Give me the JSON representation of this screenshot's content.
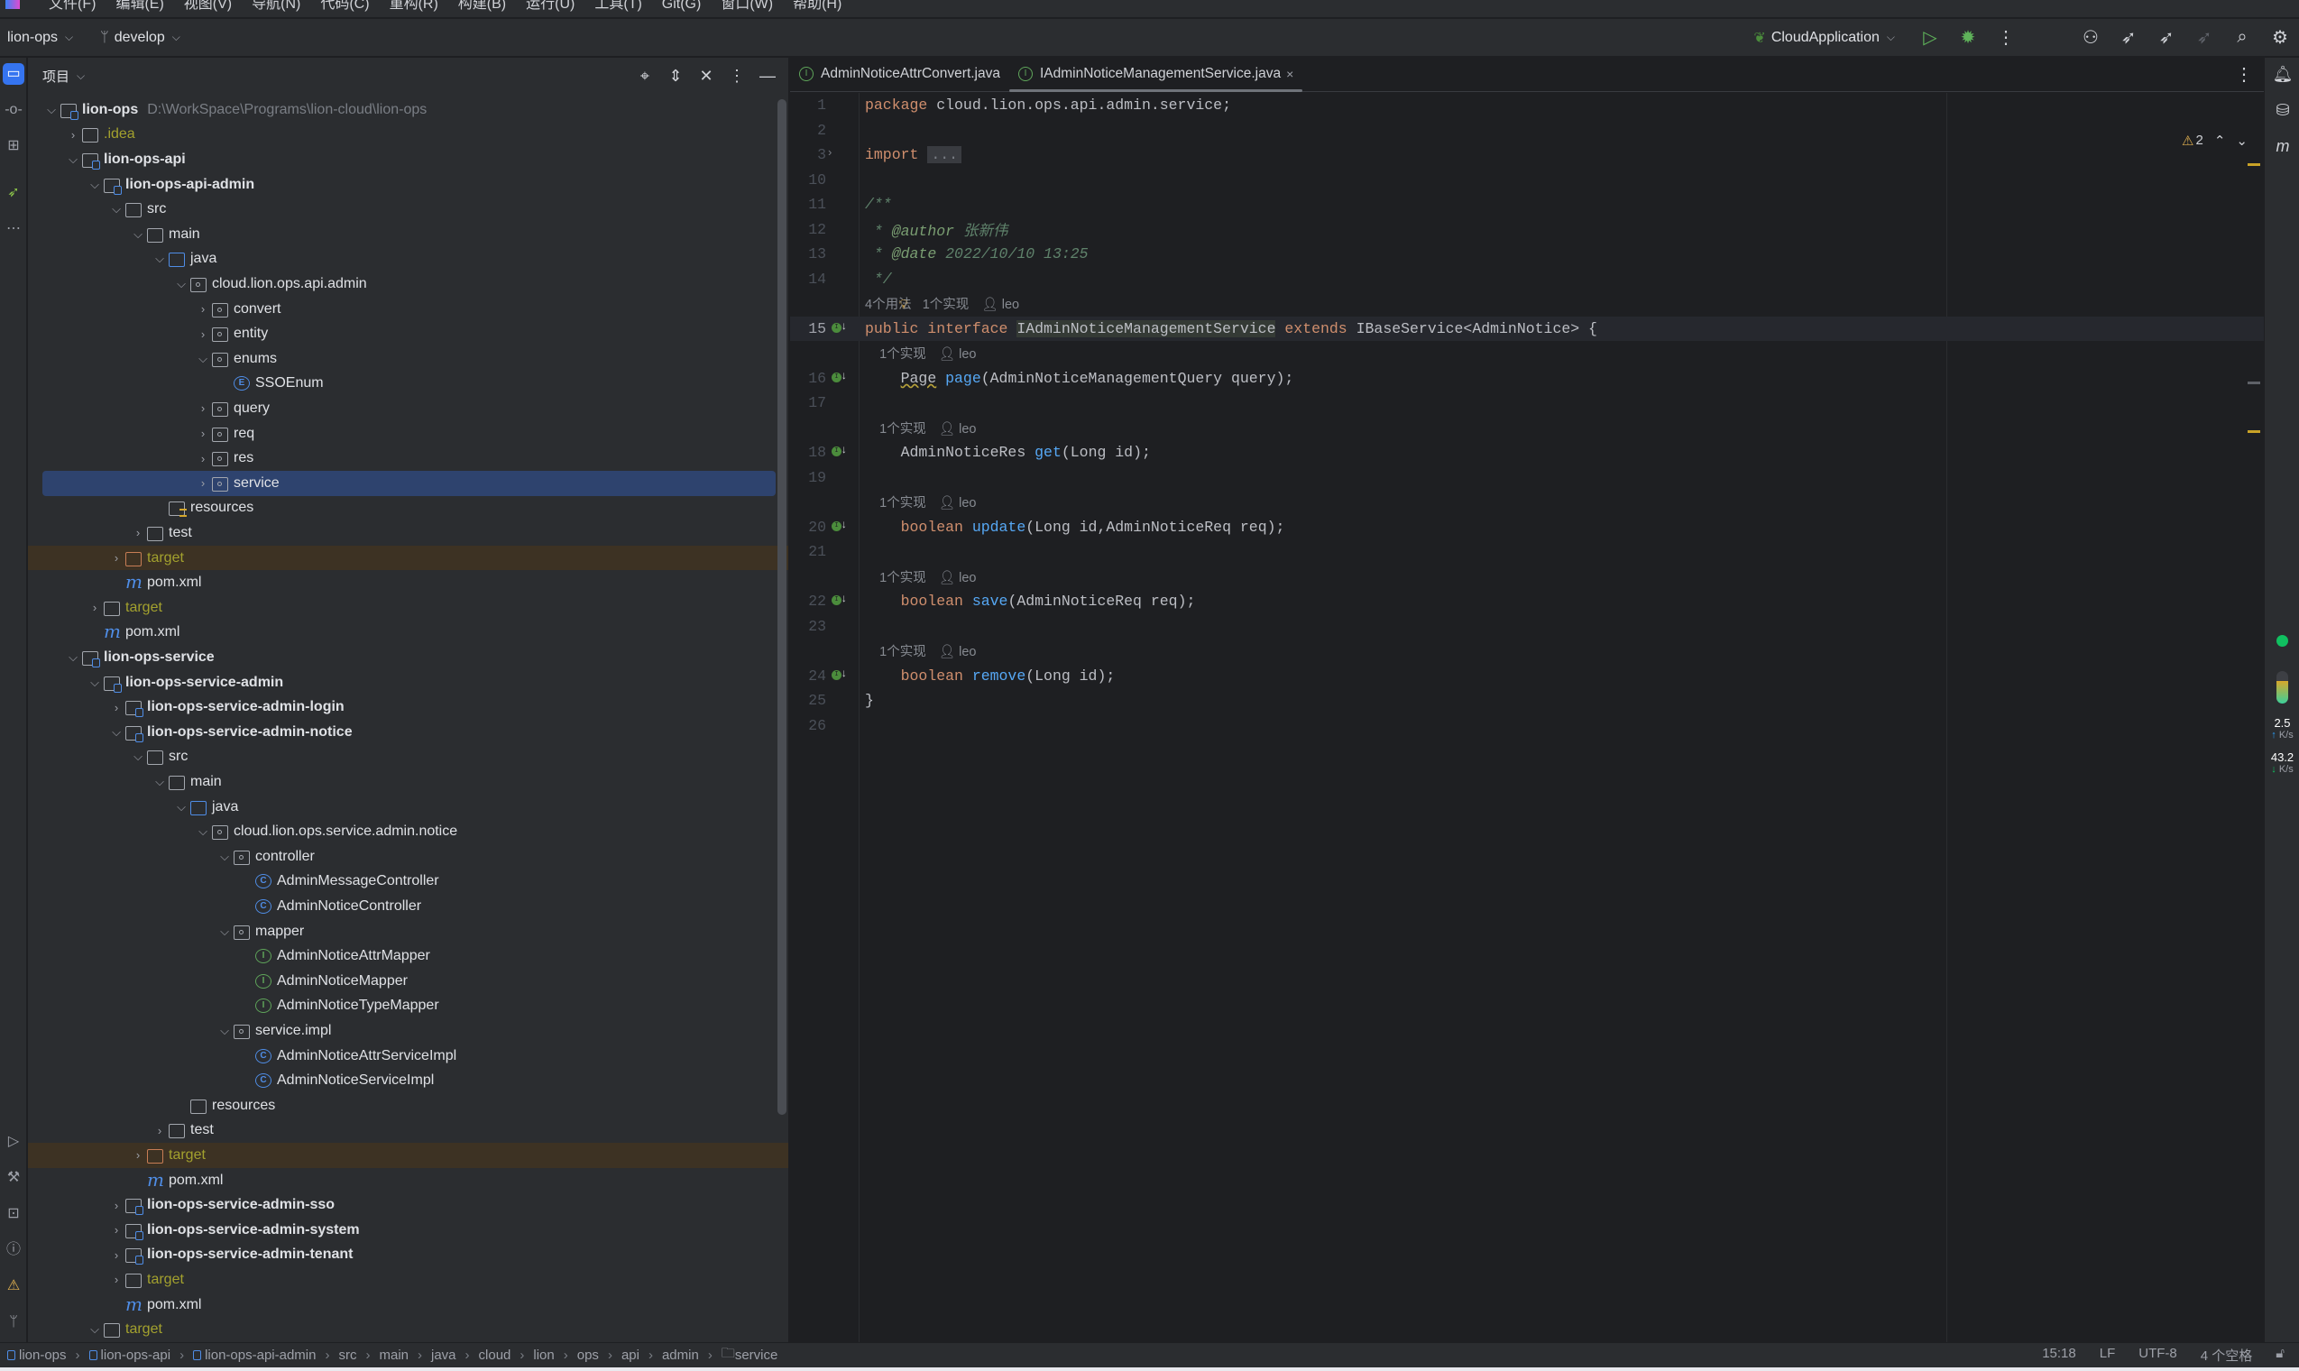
{
  "menu": [
    "文件(F)",
    "编辑(E)",
    "视图(V)",
    "导航(N)",
    "代码(C)",
    "重构(R)",
    "构建(B)",
    "运行(U)",
    "工具(T)",
    "Git(G)",
    "窗口(W)",
    "帮助(H)"
  ],
  "toolbar": {
    "project": "lion-ops",
    "branch": "develop",
    "run_config": "CloudApplication",
    "icons": [
      "run-icon",
      "debug-icon",
      "more-icon",
      "add-user-icon",
      "rocket-run-icon",
      "rocket-debug-icon",
      "rocket-icon",
      "search-icon",
      "settings-icon"
    ]
  },
  "project_panel": {
    "title": "项目",
    "tree": [
      {
        "level": 0,
        "label": "lion-ops",
        "type": "module",
        "state": "open",
        "bold": true,
        "path": "D:\\WorkSpace\\Programs\\lion-cloud\\lion-ops"
      },
      {
        "level": 1,
        "label": ".idea",
        "type": "folder",
        "state": "closed",
        "olive": true
      },
      {
        "level": 1,
        "label": "lion-ops-api",
        "type": "module",
        "state": "open",
        "bold": true
      },
      {
        "level": 2,
        "label": "lion-ops-api-admin",
        "type": "module",
        "state": "open",
        "bold": true
      },
      {
        "level": 3,
        "label": "src",
        "type": "folder",
        "state": "open"
      },
      {
        "level": 4,
        "label": "main",
        "type": "folder",
        "state": "open"
      },
      {
        "level": 5,
        "label": "java",
        "type": "source",
        "state": "open"
      },
      {
        "level": 6,
        "label": "cloud.lion.ops.api.admin",
        "type": "package",
        "state": "open"
      },
      {
        "level": 7,
        "label": "convert",
        "type": "package",
        "state": "closed"
      },
      {
        "level": 7,
        "label": "entity",
        "type": "package",
        "state": "closed"
      },
      {
        "level": 7,
        "label": "enums",
        "type": "package",
        "state": "open"
      },
      {
        "level": 8,
        "label": "SSOEnum",
        "type": "enum"
      },
      {
        "level": 7,
        "label": "query",
        "type": "package",
        "state": "closed"
      },
      {
        "level": 7,
        "label": "req",
        "type": "package",
        "state": "closed"
      },
      {
        "level": 7,
        "label": "res",
        "type": "package",
        "state": "closed"
      },
      {
        "level": 7,
        "label": "service",
        "type": "package",
        "state": "closed",
        "selected": true
      },
      {
        "level": 5,
        "label": "resources",
        "type": "resources"
      },
      {
        "level": 4,
        "label": "test",
        "type": "folder",
        "state": "closed"
      },
      {
        "level": 3,
        "label": "target",
        "type": "excluded",
        "state": "closed",
        "olive": true,
        "highlight": true
      },
      {
        "level": 3,
        "label": "pom.xml",
        "type": "maven"
      },
      {
        "level": 2,
        "label": "target",
        "type": "folder",
        "state": "closed",
        "olive": true
      },
      {
        "level": 2,
        "label": "pom.xml",
        "type": "maven"
      },
      {
        "level": 1,
        "label": "lion-ops-service",
        "type": "module",
        "state": "open",
        "bold": true
      },
      {
        "level": 2,
        "label": "lion-ops-service-admin",
        "type": "module",
        "state": "open",
        "bold": true
      },
      {
        "level": 3,
        "label": "lion-ops-service-admin-login",
        "type": "module",
        "state": "closed",
        "bold": true
      },
      {
        "level": 3,
        "label": "lion-ops-service-admin-notice",
        "type": "module",
        "state": "open",
        "bold": true
      },
      {
        "level": 4,
        "label": "src",
        "type": "folder",
        "state": "open"
      },
      {
        "level": 5,
        "label": "main",
        "type": "folder",
        "state": "open"
      },
      {
        "level": 6,
        "label": "java",
        "type": "source",
        "state": "open"
      },
      {
        "level": 7,
        "label": "cloud.lion.ops.service.admin.notice",
        "type": "package",
        "state": "open"
      },
      {
        "level": 8,
        "label": "controller",
        "type": "package",
        "state": "open"
      },
      {
        "level": 9,
        "label": "AdminMessageController",
        "type": "class"
      },
      {
        "level": 9,
        "label": "AdminNoticeController",
        "type": "class"
      },
      {
        "level": 8,
        "label": "mapper",
        "type": "package",
        "state": "open"
      },
      {
        "level": 9,
        "label": "AdminNoticeAttrMapper",
        "type": "interface"
      },
      {
        "level": 9,
        "label": "AdminNoticeMapper",
        "type": "interface"
      },
      {
        "level": 9,
        "label": "AdminNoticeTypeMapper",
        "type": "interface"
      },
      {
        "level": 8,
        "label": "service.impl",
        "type": "package",
        "state": "open"
      },
      {
        "level": 9,
        "label": "AdminNoticeAttrServiceImpl",
        "type": "class"
      },
      {
        "level": 9,
        "label": "AdminNoticeServiceImpl",
        "type": "class"
      },
      {
        "level": 6,
        "label": "resources",
        "type": "folder"
      },
      {
        "level": 5,
        "label": "test",
        "type": "folder",
        "state": "closed"
      },
      {
        "level": 4,
        "label": "target",
        "type": "excluded",
        "state": "closed",
        "olive": true,
        "highlight": true
      },
      {
        "level": 4,
        "label": "pom.xml",
        "type": "maven"
      },
      {
        "level": 3,
        "label": "lion-ops-service-admin-sso",
        "type": "module",
        "state": "closed",
        "bold": true
      },
      {
        "level": 3,
        "label": "lion-ops-service-admin-system",
        "type": "module",
        "state": "closed",
        "bold": true
      },
      {
        "level": 3,
        "label": "lion-ops-service-admin-tenant",
        "type": "module",
        "state": "closed",
        "bold": true
      },
      {
        "level": 3,
        "label": "target",
        "type": "folder",
        "state": "closed",
        "olive": true
      },
      {
        "level": 3,
        "label": "pom.xml",
        "type": "maven"
      },
      {
        "level": 2,
        "label": "target",
        "type": "folder",
        "state": "open",
        "olive": true
      }
    ]
  },
  "editor": {
    "tabs": [
      {
        "label": "AdminNoticeAttrConvert.java",
        "active": false
      },
      {
        "label": "IAdminNoticeManagementService.java",
        "active": true
      }
    ],
    "inspections": {
      "warnings": "2"
    },
    "lines": [
      {
        "n": "1",
        "t": [
          [
            "kw",
            "package "
          ],
          [
            "tx",
            "cloud.lion.ops.api.admin.service;"
          ]
        ]
      },
      {
        "n": "2",
        "t": []
      },
      {
        "n": "3",
        "fold": true,
        "t": [
          [
            "kw",
            "import "
          ],
          [
            "fold-ph",
            "..."
          ]
        ]
      },
      {
        "n": "10",
        "t": []
      },
      {
        "n": "11",
        "t": [
          [
            "cmg",
            "/**"
          ]
        ]
      },
      {
        "n": "12",
        "t": [
          [
            "cmg",
            " * "
          ],
          [
            "cm",
            "@author "
          ],
          [
            "cmg",
            "张新伟"
          ]
        ]
      },
      {
        "n": "13",
        "t": [
          [
            "cmg",
            " * "
          ],
          [
            "cm",
            "@date "
          ],
          [
            "cmg",
            "2022/10/10 13:25"
          ]
        ]
      },
      {
        "n": "14",
        "t": [
          [
            "cmg",
            " */"
          ]
        ]
      },
      {
        "hint": {
          "a": "4个用法",
          "b": "1个实现",
          "c": "leo"
        },
        "indent": ""
      },
      {
        "n": "15",
        "cur": true,
        "impl": true,
        "t": [
          [
            "kw",
            "public interface "
          ],
          [
            "tx hl",
            "IAdminNoticeManagementService"
          ],
          [
            "kw",
            " extends "
          ],
          [
            "tx",
            "IBaseService<AdminNotice> {"
          ]
        ]
      },
      {
        "hint": {
          "b": "1个实现",
          "c": "leo"
        },
        "indent": "    "
      },
      {
        "n": "16",
        "impl": true,
        "t": [
          [
            "tx",
            "    "
          ],
          [
            "tx ul",
            "Page"
          ],
          [
            "tx",
            " "
          ],
          [
            "fn",
            "page"
          ],
          [
            "tx",
            "(AdminNoticeManagementQuery query);"
          ]
        ]
      },
      {
        "n": "17",
        "t": []
      },
      {
        "hint": {
          "b": "1个实现",
          "c": "leo"
        },
        "indent": "    "
      },
      {
        "n": "18",
        "impl": true,
        "t": [
          [
            "tx",
            "    AdminNoticeRes "
          ],
          [
            "fn",
            "get"
          ],
          [
            "tx",
            "(Long id);"
          ]
        ]
      },
      {
        "n": "19",
        "t": []
      },
      {
        "hint": {
          "b": "1个实现",
          "c": "leo"
        },
        "indent": "    "
      },
      {
        "n": "20",
        "impl": true,
        "t": [
          [
            "tx",
            "    "
          ],
          [
            "kw",
            "boolean "
          ],
          [
            "fn",
            "update"
          ],
          [
            "tx",
            "(Long id,AdminNoticeReq req);"
          ]
        ]
      },
      {
        "n": "21",
        "t": []
      },
      {
        "hint": {
          "b": "1个实现",
          "c": "leo"
        },
        "indent": "    "
      },
      {
        "n": "22",
        "impl": true,
        "t": [
          [
            "tx",
            "    "
          ],
          [
            "kw",
            "boolean "
          ],
          [
            "fn",
            "save"
          ],
          [
            "tx",
            "(AdminNoticeReq req);"
          ]
        ]
      },
      {
        "n": "23",
        "t": []
      },
      {
        "hint": {
          "b": "1个实现",
          "c": "leo"
        },
        "indent": "    "
      },
      {
        "n": "24",
        "impl": true,
        "t": [
          [
            "tx",
            "    "
          ],
          [
            "kw",
            "boolean "
          ],
          [
            "fn",
            "remove"
          ],
          [
            "tx",
            "(Long id);"
          ]
        ]
      },
      {
        "n": "25",
        "t": [
          [
            "tx",
            "}"
          ]
        ]
      },
      {
        "n": "26",
        "t": []
      }
    ]
  },
  "right_strip": {
    "net_up": "2.5",
    "net_up_unit": "K/s",
    "net_down": "43.2",
    "net_down_unit": "K/s"
  },
  "status": {
    "breadcrumb": [
      {
        "label": "lion-ops",
        "module": true
      },
      {
        "label": "lion-ops-api",
        "module": true
      },
      {
        "label": "lion-ops-api-admin",
        "module": true
      },
      {
        "label": "src"
      },
      {
        "label": "main"
      },
      {
        "label": "java"
      },
      {
        "label": "cloud"
      },
      {
        "label": "lion"
      },
      {
        "label": "ops"
      },
      {
        "label": "api"
      },
      {
        "label": "admin"
      },
      {
        "label": "service",
        "package": true
      }
    ],
    "position": "15:18",
    "line_sep": "LF",
    "encoding": "UTF-8",
    "indent": "4 个空格"
  },
  "colors": {
    "accent": "#3574f0",
    "selection": "#2e436e",
    "excluded_bg": "#3d3223",
    "keyword": "#cf8e6d",
    "function": "#56a8f5"
  }
}
